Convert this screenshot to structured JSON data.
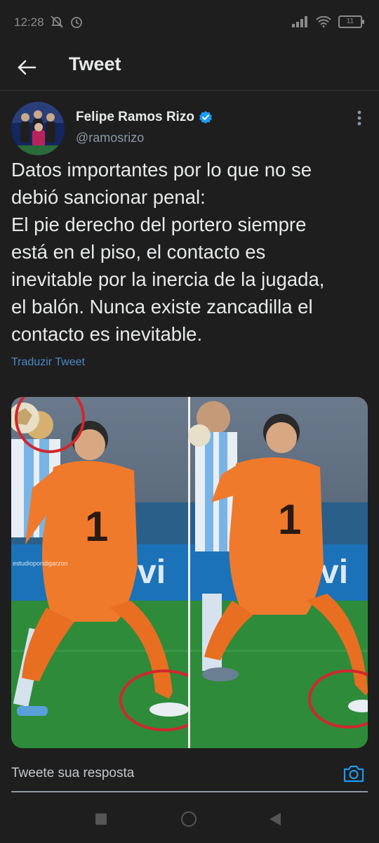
{
  "status_bar": {
    "time": "12:28",
    "battery": "11"
  },
  "app_bar": {
    "title": "Tweet"
  },
  "author": {
    "name": "Felipe Ramos Rizo",
    "handle": "@ramosrizo"
  },
  "tweet": {
    "text": "Datos importantes por lo que no se\ndebió sancionar penal:\nEl pie derecho del portero siempre\nestá en el piso, el contacto es\ninevitable por la inercia de la jugada,\nel balón. Nunca existe zancadilla el\ncontacto es inevitable.",
    "translate_label": "Traduzir Tweet"
  },
  "media": {
    "watermark": "estudiopondigarzon"
  },
  "reply": {
    "placeholder": "Tweete sua resposta"
  },
  "colors": {
    "background": "#1e1e1e",
    "link": "#4a8bc5",
    "verified": "#1d9bf0",
    "keeper_kit": "#f07a2b",
    "pitch": "#2e8b3a",
    "circle": "#d0282e"
  }
}
